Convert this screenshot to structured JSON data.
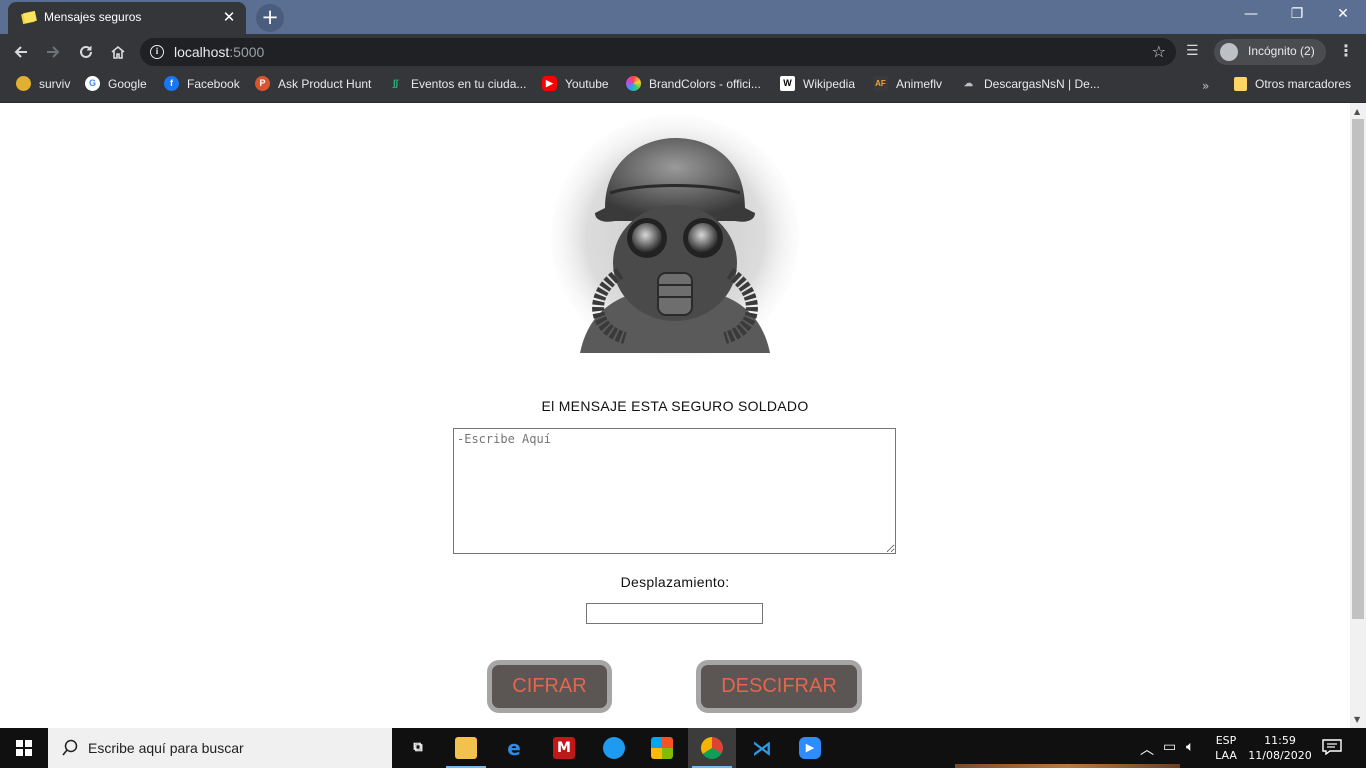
{
  "browser": {
    "tab_title": "Mensajes seguros",
    "tab_close": "✕",
    "new_tab": "+",
    "url_host": "localhost",
    "url_port": ":5000",
    "incognito_label": "Incógnito (2)",
    "window_controls": {
      "minimize": "—",
      "restore": "❐",
      "close": "✕"
    }
  },
  "bookmarks": [
    {
      "label": "surviv",
      "icon": "surviv-icon",
      "color": "#e0b030"
    },
    {
      "label": "Google",
      "icon": "google-icon",
      "color": "#ffffff"
    },
    {
      "label": "Facebook",
      "icon": "facebook-icon",
      "color": "#1877f2"
    },
    {
      "label": "Ask Product Hunt",
      "icon": "product-hunt-icon",
      "color": "#da552f"
    },
    {
      "label": "Eventos en tu ciuda...",
      "icon": "eventos-icon",
      "color": "#2fb380"
    },
    {
      "label": "Youtube",
      "icon": "youtube-icon",
      "color": "#ff0000"
    },
    {
      "label": "BrandColors - offici...",
      "icon": "brandcolors-icon",
      "color": "#c04bd8"
    },
    {
      "label": "Wikipedia",
      "icon": "wikipedia-icon",
      "color": "#ffffff"
    },
    {
      "label": "Animeflv",
      "icon": "animeflv-icon",
      "color": "#3a3a3a"
    },
    {
      "label": "DescargasNsN | De...",
      "icon": "descargas-icon",
      "color": "#35363a"
    }
  ],
  "bookmarks_more": "»",
  "other_bookmarks": "Otros marcadores",
  "page": {
    "heading": "El MENSAJE ESTA SEGURO SOLDADO",
    "message_placeholder": "-Escribe Aquí",
    "shift_label": "Desplazamiento:",
    "shift_value": "",
    "encrypt_button": "CIFRAR",
    "decrypt_button": "DESCIFRAR"
  },
  "taskbar": {
    "search_placeholder": "Escribe aquí para buscar",
    "lang_line1": "ESP",
    "lang_line2": "LAA",
    "time": "11:59",
    "date": "11/08/2020"
  },
  "colors": {
    "button_bg": "#5b5554",
    "button_border": "#a6a6a6",
    "button_text": "#e6654c",
    "chrome_dark": "#35363a",
    "titlebar": "#5a6f92"
  }
}
